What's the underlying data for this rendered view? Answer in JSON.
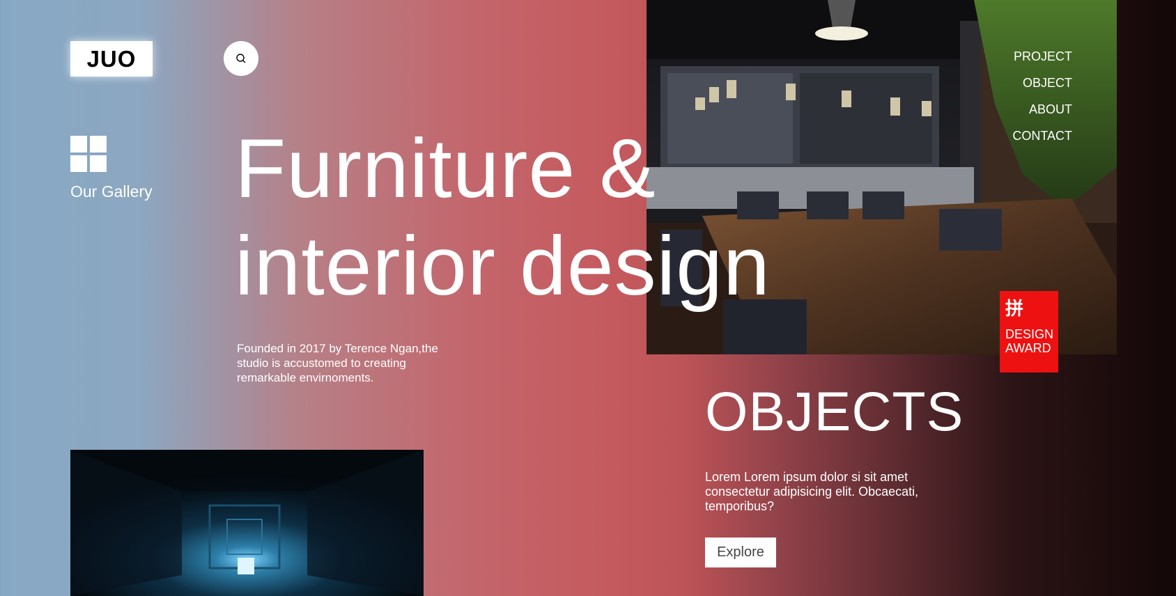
{
  "brand": {
    "logo_text": "JUO"
  },
  "header": {
    "search_icon": "search-icon"
  },
  "sidebar": {
    "gallery_icon": "grid-icon",
    "gallery_label": "Our Gallery"
  },
  "hero": {
    "title_line1": "Furniture &",
    "title_line2": "interior design",
    "description": "Founded in 2017 by Terence Ngan,the studio is accustomed to creating remarkable envirnoments."
  },
  "nav": {
    "items": [
      "PROJECT",
      "OBJECT",
      "ABOUT",
      "CONTACT"
    ]
  },
  "award": {
    "glyph": "拼",
    "label_line1": "DESIGN",
    "label_line2": "AWARD",
    "color": "#ee1111"
  },
  "objects": {
    "title": "OBJECTS",
    "description": "Lorem Lorem ipsum dolor si sit amet consectetur adipisicing elit. Obcaecati, temporibus?",
    "button_label": "Explore"
  }
}
